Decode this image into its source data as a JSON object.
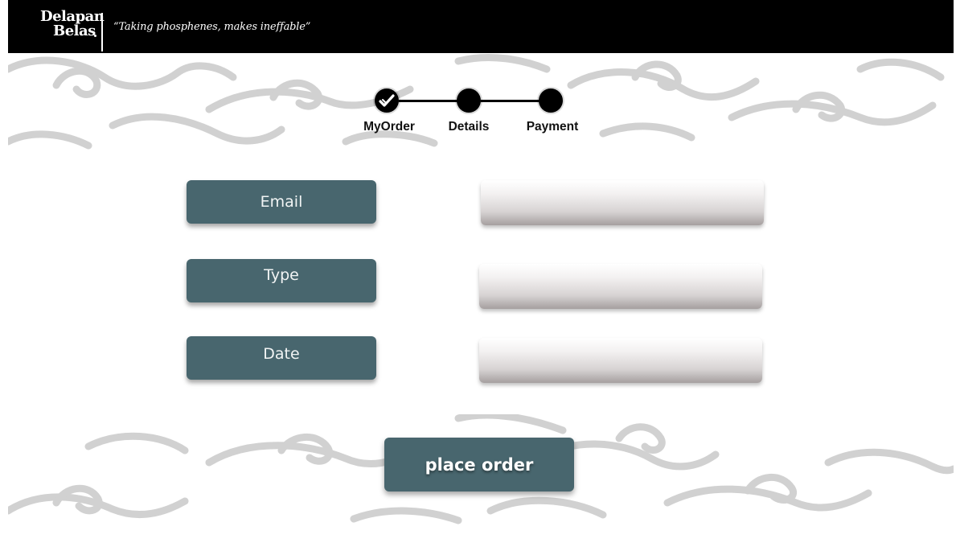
{
  "brand": {
    "logo_line1": "Delapan",
    "logo_line2": "Belas",
    "tagline": "“Taking phosphenes, makes ineffable”"
  },
  "stepper": {
    "steps": [
      {
        "label": "MyOrder",
        "state": "completed"
      },
      {
        "label": "Details",
        "state": "pending"
      },
      {
        "label": "Payment",
        "state": "pending"
      }
    ]
  },
  "form": {
    "fields": [
      {
        "label": "Email",
        "value": ""
      },
      {
        "label": "Type",
        "value": ""
      },
      {
        "label": "Date",
        "value": ""
      }
    ],
    "submit_label": "place order"
  },
  "colors": {
    "header_bg": "#000000",
    "accent": "#48666e",
    "pattern": "#cfcfcf"
  },
  "icons": {
    "completed_step": "check-icon",
    "background": "batik-cloud-pattern"
  }
}
